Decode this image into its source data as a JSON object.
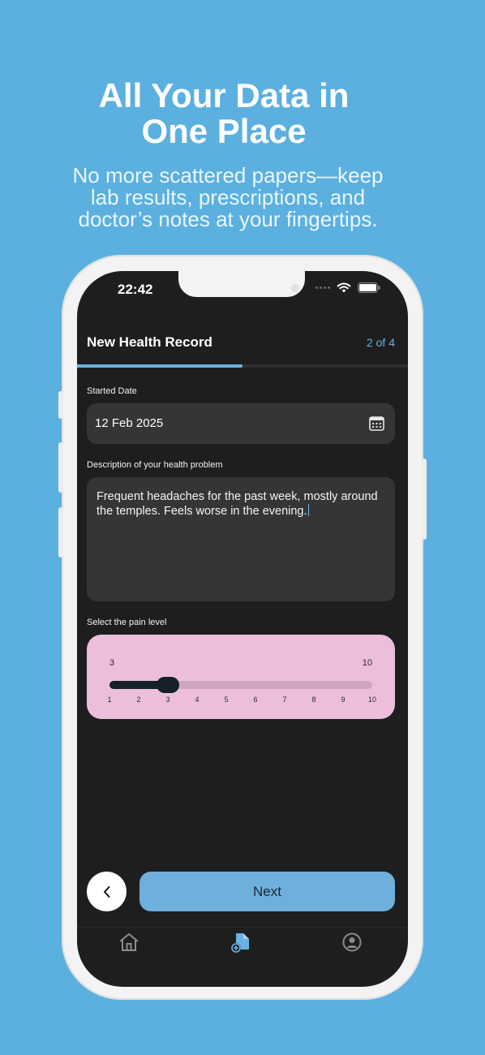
{
  "promo": {
    "headline_line1": "All Your Data in",
    "headline_line2": "One Place",
    "subhead_line1": "No more scattered papers—keep",
    "subhead_line2": "lab results, prescriptions, and",
    "subhead_line3": "doctor’s notes at your fingertips."
  },
  "status_bar": {
    "time": "22:42",
    "icons": [
      "cellular-signal-icon",
      "wifi-icon",
      "battery-icon"
    ]
  },
  "header": {
    "title": "New Health Record",
    "step": "2 of 4",
    "progress_fraction": 0.5
  },
  "form": {
    "start_date_label": "Started Date",
    "start_date_value": "12 Feb 2025",
    "description_label": "Description of your health problem",
    "description_value": "Frequent headaches for the past week, mostly around the temples. Feels worse in the evening.",
    "pain_label": "Select the pain level",
    "pain": {
      "current": "3",
      "max_label": "10",
      "value": 3,
      "min": 1,
      "max": 10,
      "ticks": [
        "1",
        "2",
        "3",
        "4",
        "5",
        "6",
        "7",
        "8",
        "9",
        "10"
      ]
    }
  },
  "actions": {
    "next_label": "Next"
  },
  "tabs": [
    {
      "icon": "home-icon",
      "active": false
    },
    {
      "icon": "add-document-icon",
      "active": true
    },
    {
      "icon": "profile-icon",
      "active": false
    }
  ],
  "colors": {
    "background": "#5BB0E0",
    "accent": "#6AB2E2",
    "screen": "#1E1E1F",
    "pain_card": "#EDBEDC",
    "slider_dark": "#14202A"
  }
}
